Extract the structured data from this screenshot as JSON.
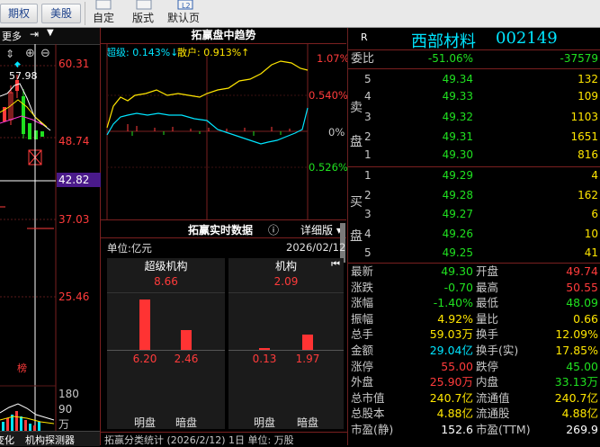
{
  "toolbar": {
    "btn_futures": "期权",
    "btn_us": "美股",
    "custom": "自定",
    "layout": "版式",
    "default_page": "默认页"
  },
  "kline": {
    "more": "更多",
    "price_high": "60.31",
    "price_mark": "57.98",
    "price_2": "48.74",
    "price_cursor": "42.82",
    "price_3": "37.03",
    "price_4": "25.46",
    "vol_1": "180",
    "vol_2": "90",
    "vol_unit": "万",
    "rank_label": "榜",
    "tab_1": "变化",
    "tab_2": "机构探测器"
  },
  "trend": {
    "title": "拓赢盘中趋势",
    "super_label": "超级: 0.143%↓",
    "retail_label": "散户: 0.913%↑",
    "axis_top": "1.07%",
    "axis_2": "0.540%",
    "axis_mid": "0%",
    "axis_low": "0.526%"
  },
  "realtime": {
    "title": "拓赢实时数据",
    "detail": "详细版",
    "unit": "单位:亿元",
    "date": "2026/02/12",
    "super_title": "超级机构",
    "super_total": "8.66",
    "super_bright": "6.20",
    "super_dark": "2.46",
    "inst_title": "机构",
    "inst_total": "2.09",
    "inst_bright": "0.13",
    "inst_dark": "1.97",
    "bright_label": "明盘",
    "dark_label": "暗盘",
    "footer": "拓赢分类统计 (2026/2/12) 1日    单位: 万股"
  },
  "quote": {
    "r_label": "R",
    "stock_name": "西部材料",
    "stock_code": "002149",
    "weibi_label": "委比",
    "weibi_pct": "-51.06%",
    "weibi_val": "-37579",
    "sell_label": "卖盘",
    "buy_label": "买盘",
    "sell": [
      {
        "lvl": "5",
        "px": "49.34",
        "vol": "132"
      },
      {
        "lvl": "4",
        "px": "49.33",
        "vol": "109"
      },
      {
        "lvl": "3",
        "px": "49.32",
        "vol": "1103"
      },
      {
        "lvl": "2",
        "px": "49.31",
        "vol": "1651"
      },
      {
        "lvl": "1",
        "px": "49.30",
        "vol": "816"
      }
    ],
    "buy": [
      {
        "lvl": "1",
        "px": "49.29",
        "vol": "4"
      },
      {
        "lvl": "2",
        "px": "49.28",
        "vol": "162"
      },
      {
        "lvl": "3",
        "px": "49.27",
        "vol": "6"
      },
      {
        "lvl": "4",
        "px": "49.26",
        "vol": "10"
      },
      {
        "lvl": "5",
        "px": "49.25",
        "vol": "41"
      }
    ],
    "stats": [
      {
        "l1": "最新",
        "v1": "49.30",
        "c1": "green",
        "l2": "开盘",
        "v2": "49.74",
        "c2": "red"
      },
      {
        "l1": "涨跌",
        "v1": "-0.70",
        "c1": "green",
        "l2": "最高",
        "v2": "50.55",
        "c2": "red"
      },
      {
        "l1": "涨幅",
        "v1": "-1.40%",
        "c1": "green",
        "l2": "最低",
        "v2": "48.09",
        "c2": "green"
      },
      {
        "l1": "振幅",
        "v1": "4.92%",
        "c1": "yellow",
        "l2": "量比",
        "v2": "0.66",
        "c2": "yellow"
      },
      {
        "l1": "总手",
        "v1": "59.03万",
        "c1": "yellow",
        "l2": "换手",
        "v2": "12.09%",
        "c2": "yellow"
      },
      {
        "l1": "金额",
        "v1": "29.04亿",
        "c1": "cyan",
        "l2": "换手(实)",
        "v2": "17.85%",
        "c2": "yellow"
      },
      {
        "l1": "涨停",
        "v1": "55.00",
        "c1": "red",
        "l2": "跌停",
        "v2": "45.00",
        "c2": "green"
      },
      {
        "l1": "外盘",
        "v1": "25.90万",
        "c1": "red",
        "l2": "内盘",
        "v2": "33.13万",
        "c2": "green"
      },
      {
        "l1": "总市值",
        "v1": "240.7亿",
        "c1": "yellow",
        "l2": "流通值",
        "v2": "240.7亿",
        "c2": "yellow"
      },
      {
        "l1": "总股本",
        "v1": "4.88亿",
        "c1": "yellow",
        "l2": "流通股",
        "v2": "4.88亿",
        "c2": "yellow"
      },
      {
        "l1": "市盈(静)",
        "v1": "152.6",
        "c1": "white",
        "l2": "市盈(TTM)",
        "v2": "269.9",
        "c2": "white"
      }
    ]
  },
  "colors": {
    "up": "#ff3b3b",
    "down": "#20e020",
    "accent": "#00e5ff",
    "volume": "#ffe600",
    "cursor_band": "#4a1a8a"
  }
}
